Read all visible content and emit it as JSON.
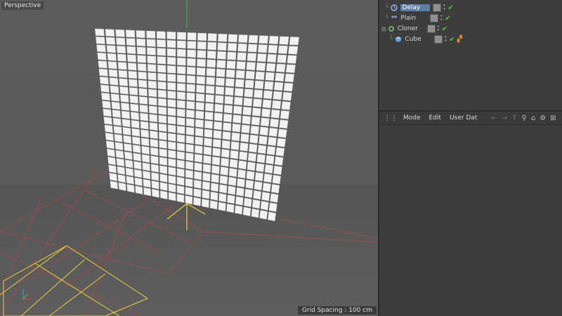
{
  "viewport": {
    "label": "Perspective",
    "grid_spacing": "Grid Spacing : 100 cm"
  },
  "object_manager": {
    "items": [
      {
        "label": "Delay",
        "icon": "delay-effector-icon",
        "selected": true
      },
      {
        "label": "Plain",
        "icon": "plain-effector-icon"
      },
      {
        "label": "Cloner",
        "icon": "cloner-icon"
      },
      {
        "label": "Cube",
        "icon": "cube-icon"
      }
    ]
  },
  "attribute_manager": {
    "menu": [
      "Mode",
      "Edit",
      "User Dat"
    ]
  },
  "colors": {
    "selection": "#5c7fa9",
    "check": "#56c24a",
    "grid_red": "#b04a4a",
    "axis_yellow": "#e6d23a"
  }
}
